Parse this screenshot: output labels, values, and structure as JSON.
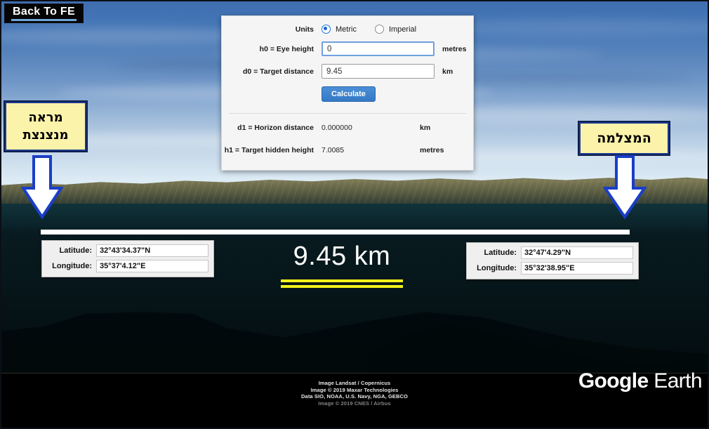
{
  "nav": {
    "back_label": "Back To FE"
  },
  "annotations": {
    "left_label": "מראה\nמנצנצת",
    "left_label_line1": "מראה",
    "left_label_line2": "מנצנצת",
    "right_label": "המצלמה"
  },
  "measurement": {
    "distance_text": "9.45 km"
  },
  "coords_left": {
    "latitude_label": "Latitude:",
    "latitude_value": "32°43'34.37\"N",
    "longitude_label": "Longitude:",
    "longitude_value": "35°37'4.12\"E"
  },
  "coords_right": {
    "latitude_label": "Latitude:",
    "latitude_value": "32°47'4.29\"N",
    "longitude_label": "Longitude:",
    "longitude_value": "35°32'38.95\"E"
  },
  "calculator": {
    "units_label": "Units",
    "metric_label": "Metric",
    "imperial_label": "Imperial",
    "metric_selected": true,
    "eye_height_label": "h0 = Eye height",
    "eye_height_value": "0",
    "eye_height_unit": "metres",
    "target_distance_label": "d0 = Target distance",
    "target_distance_value": "9.45",
    "target_distance_unit": "km",
    "calculate_label": "Calculate",
    "horizon_label": "d1 = Horizon distance",
    "horizon_value": "0.000000",
    "horizon_unit": "km",
    "hidden_label": "h1 = Target hidden height",
    "hidden_value": "7.0085",
    "hidden_unit": "metres"
  },
  "attribution": {
    "line1": "Image Landsat / Copernicus",
    "line2": "Image © 2019 Maxar Technologies",
    "line3": "Data SIO, NOAA, U.S. Navy, NGA, GEBCO",
    "line4": "Image © 2019 CNES / Airbus",
    "logo_bold": "Google",
    "logo_light": " Earth"
  },
  "colors": {
    "accent_blue": "#3479c4",
    "label_yellow": "#fcf3aa",
    "label_border": "#1d3a8f",
    "measure_yellow": "#f2f219",
    "arrow_outline": "#1a3ec8"
  }
}
